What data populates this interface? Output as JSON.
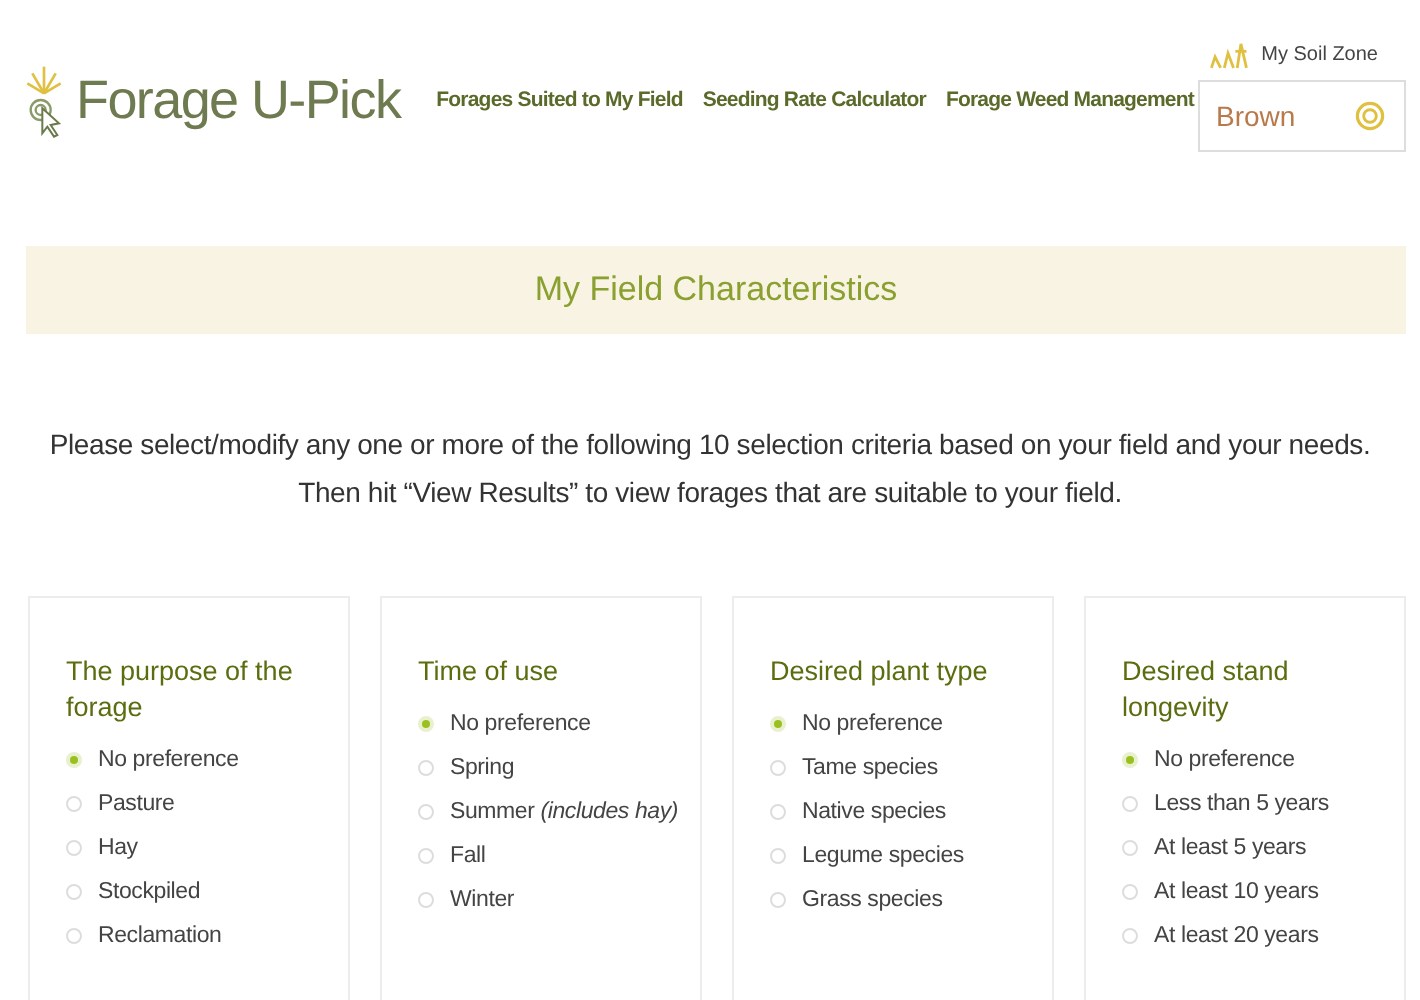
{
  "header": {
    "logo": "Forage U-Pick",
    "nav": [
      "Forages Suited to My Field",
      "Seeding Rate Calculator",
      "Forage Weed Management"
    ],
    "soil_zone_label": "My Soil Zone",
    "soil_zone_value": "Brown"
  },
  "banner": {
    "title": "My Field Characteristics"
  },
  "intro": [
    "Please select/modify any one or more of the following 10 selection criteria based on your field and your needs.",
    "Then hit “View Results” to view forages that are suitable to your field."
  ],
  "criteria": [
    {
      "title": "The purpose of the forage",
      "options": [
        {
          "label": "No preference",
          "selected": true
        },
        {
          "label": "Pasture",
          "selected": false
        },
        {
          "label": "Hay",
          "selected": false
        },
        {
          "label": "Stockpiled",
          "selected": false
        },
        {
          "label": "Reclamation",
          "selected": false
        }
      ]
    },
    {
      "title": "Time of use",
      "options": [
        {
          "label": "No preference",
          "selected": true
        },
        {
          "label": "Spring",
          "selected": false
        },
        {
          "label": "Summer *(includes hay)*",
          "selected": false
        },
        {
          "label": "Fall",
          "selected": false
        },
        {
          "label": "Winter",
          "selected": false
        }
      ]
    },
    {
      "title": "Desired plant type",
      "options": [
        {
          "label": "No preference",
          "selected": true
        },
        {
          "label": "Tame species",
          "selected": false
        },
        {
          "label": "Native species",
          "selected": false
        },
        {
          "label": "Legume species",
          "selected": false
        },
        {
          "label": "Grass species",
          "selected": false
        }
      ]
    },
    {
      "title": "Desired stand longevity",
      "options": [
        {
          "label": "No preference",
          "selected": true
        },
        {
          "label": "Less than 5 years",
          "selected": false
        },
        {
          "label": "At least 5 years",
          "selected": false
        },
        {
          "label": "At least 10 years",
          "selected": false
        },
        {
          "label": "At least 20 years",
          "selected": false
        }
      ]
    }
  ]
}
